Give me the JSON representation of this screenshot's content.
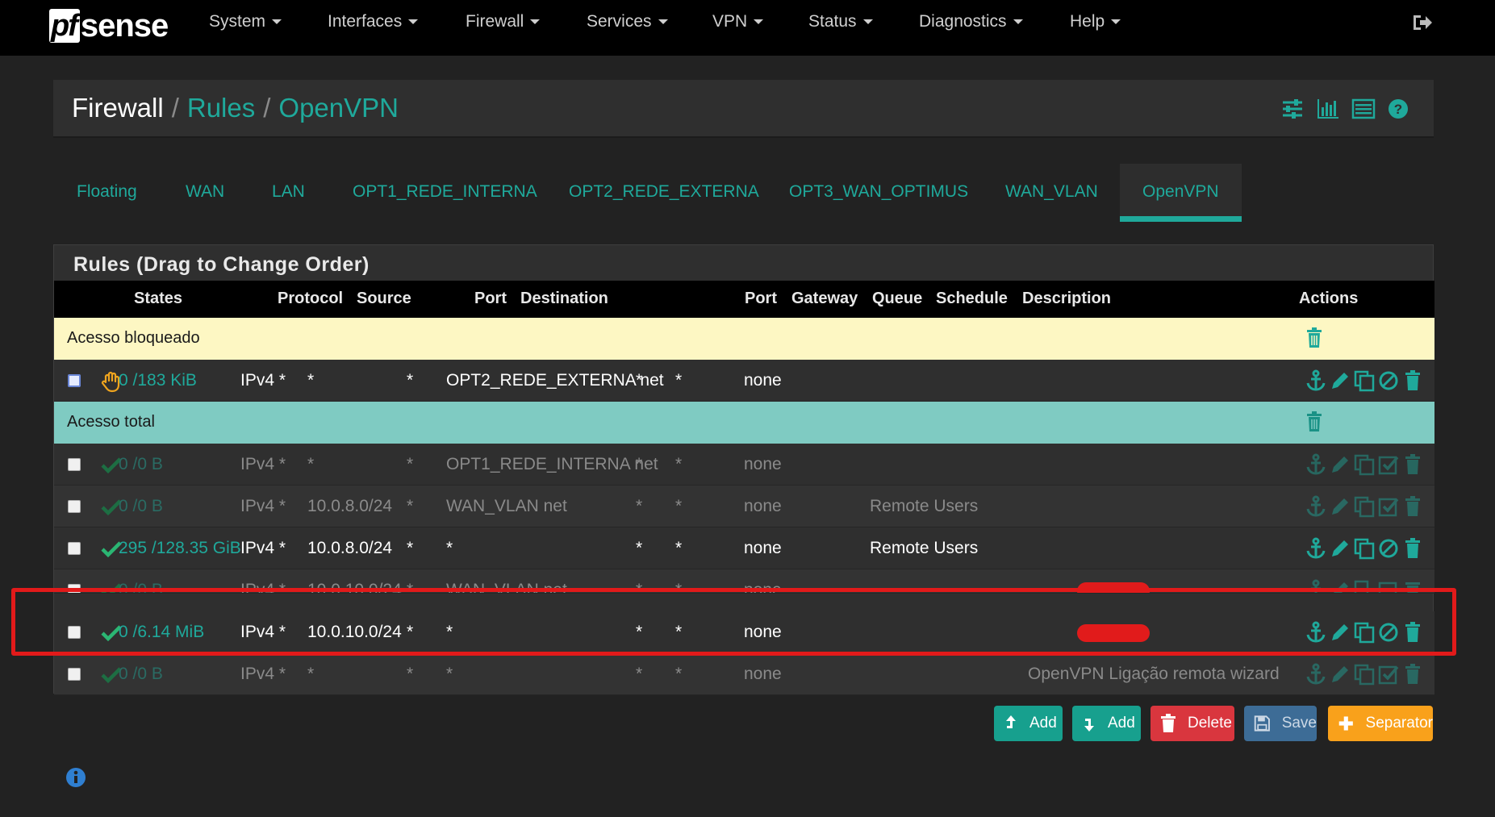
{
  "brand": {
    "pf": "pf",
    "sense": "sense"
  },
  "nav": {
    "items": [
      {
        "label": "System"
      },
      {
        "label": "Interfaces"
      },
      {
        "label": "Firewall"
      },
      {
        "label": "Services"
      },
      {
        "label": "VPN"
      },
      {
        "label": "Status"
      },
      {
        "label": "Diagnostics"
      },
      {
        "label": "Help"
      }
    ]
  },
  "breadcrumb": {
    "root": "Firewall",
    "sep": "/",
    "rules": "Rules",
    "current": "OpenVPN"
  },
  "tabs": [
    "Floating",
    "WAN",
    "LAN",
    "OPT1_REDE_INTERNA",
    "OPT2_REDE_EXTERNA",
    "OPT3_WAN_OPTIMUS",
    "WAN_VLAN",
    "OpenVPN"
  ],
  "panel": {
    "title": "Rules (Drag to Change Order)"
  },
  "columns": {
    "states": "States",
    "protocol": "Protocol",
    "source": "Source",
    "port": "Port",
    "destination": "Destination",
    "port2": "Port",
    "gateway": "Gateway",
    "queue": "Queue",
    "schedule": "Schedule",
    "description": "Description",
    "actions": "Actions"
  },
  "separators": {
    "blocked": "Acesso bloqueado",
    "total": "Acesso total"
  },
  "rules": [
    {
      "states": "0 /183 KiB",
      "protocol": "IPv4 *",
      "source": "*",
      "port": "*",
      "destination": "OPT2_REDE_EXTERNA net",
      "dport": "*",
      "gateway": "*",
      "queue": "none",
      "description": "",
      "icon": "block-hand-icon",
      "enabled": true
    },
    {
      "states": "0 /0 B",
      "protocol": "IPv4 *",
      "source": "*",
      "port": "*",
      "destination": "OPT1_REDE_INTERNA net",
      "dport": "*",
      "gateway": "*",
      "queue": "none",
      "description": "",
      "icon": "pass-check-icon",
      "enabled": false
    },
    {
      "states": "0 /0 B",
      "protocol": "IPv4 *",
      "source": "10.0.8.0/24",
      "port": "*",
      "destination": "WAN_VLAN net",
      "dport": "*",
      "gateway": "*",
      "queue": "none",
      "description": "Remote Users",
      "icon": "pass-check-icon",
      "enabled": false
    },
    {
      "states": "295 /128.35 GiB",
      "protocol": "IPv4 *",
      "source": "10.0.8.0/24",
      "port": "*",
      "destination": "*",
      "dport": "*",
      "gateway": "*",
      "queue": "none",
      "description": "Remote Users",
      "icon": "pass-check-icon",
      "enabled": true
    },
    {
      "states": "0 /0 B",
      "protocol": "IPv4 *",
      "source": "10.0.10.0/24",
      "port": "*",
      "destination": "WAN_VLAN net",
      "dport": "*",
      "gateway": "*",
      "queue": "none",
      "description": "",
      "icon": "pass-check-icon",
      "enabled": false
    },
    {
      "states": "0 /6.14 MiB",
      "protocol": "IPv4 *",
      "source": "10.0.10.0/24",
      "port": "*",
      "destination": "*",
      "dport": "*",
      "gateway": "*",
      "queue": "none",
      "description": "",
      "icon": "pass-check-icon",
      "enabled": true
    },
    {
      "states": "0 /0 B",
      "protocol": "IPv4 *",
      "source": "*",
      "port": "*",
      "destination": "*",
      "dport": "*",
      "gateway": "*",
      "queue": "none",
      "description": "OpenVPN Ligação remota wizard",
      "icon": "pass-check-icon",
      "enabled": false
    }
  ],
  "buttons": {
    "add_top": "Add",
    "add_bottom": "Add",
    "delete": "Delete",
    "save": "Save",
    "separator": "Separator"
  },
  "colors": {
    "accent": "#1fa99b",
    "highlight": "#e21a1a",
    "sep_yellow": "#fdf7c3",
    "sep_teal": "#7fcbc2"
  }
}
